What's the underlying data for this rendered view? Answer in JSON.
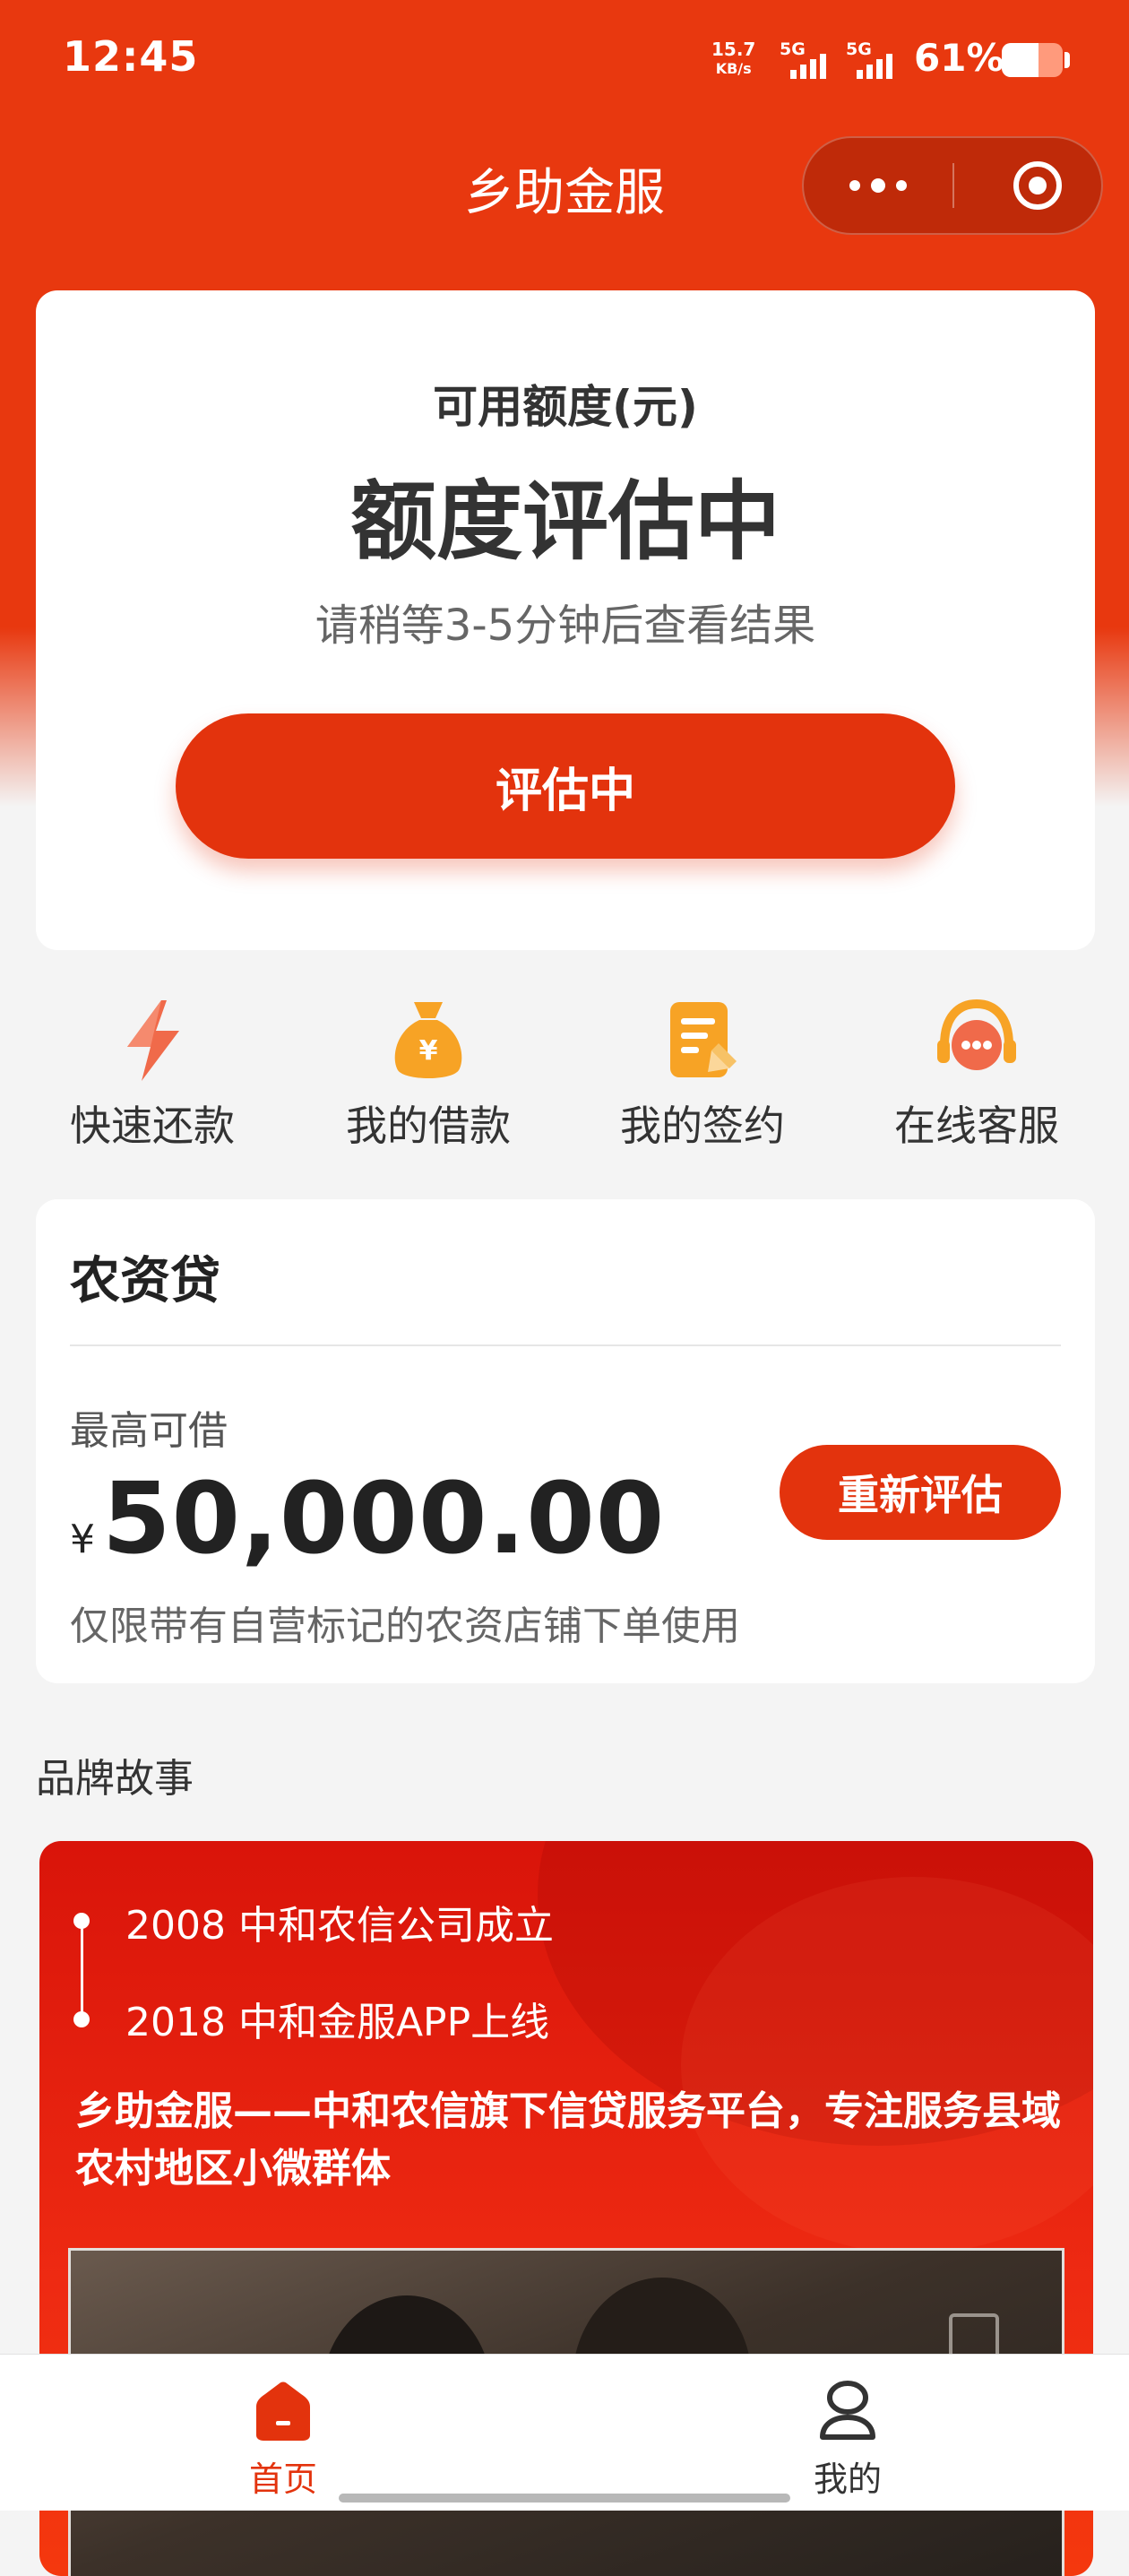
{
  "status_bar": {
    "time": "12:45",
    "net_speed_value": "15.7",
    "net_speed_unit": "KB/s",
    "signal_1_label": "5G",
    "signal_2_label": "5G",
    "battery_percent": "61%",
    "battery_level": 0.61
  },
  "header": {
    "title": "乡助金服"
  },
  "credit_card": {
    "label": "可用额度(元)",
    "status": "额度评估中",
    "hint": "请稍等3-5分钟后查看结果",
    "button_label": "评估中"
  },
  "quick_actions": [
    {
      "label": "快速还款",
      "icon": "lightning-icon"
    },
    {
      "label": "我的借款",
      "icon": "money-bag-icon"
    },
    {
      "label": "我的签约",
      "icon": "contract-icon"
    },
    {
      "label": "在线客服",
      "icon": "headset-icon"
    }
  ],
  "loan_card": {
    "title": "农资贷",
    "max_label": "最高可借",
    "currency": "¥",
    "amount": "50,000.00",
    "button_label": "重新评估",
    "note": "仅限带有自营标记的农资店铺下单使用"
  },
  "brand": {
    "heading": "品牌故事",
    "timeline": [
      "2008 中和农信公司成立",
      "2018 中和金服APP上线"
    ],
    "description": "乡助金服——中和农信旗下信贷服务平台，专注服务县域农村地区小微群体"
  },
  "tabbar": {
    "items": [
      {
        "label": "首页",
        "icon": "home-icon",
        "active": true
      },
      {
        "label": "我的",
        "icon": "profile-icon",
        "active": false
      }
    ]
  },
  "colors": {
    "brand_red": "#e8380f",
    "button_red": "#e3330d",
    "icon_orange": "#f5a623"
  }
}
